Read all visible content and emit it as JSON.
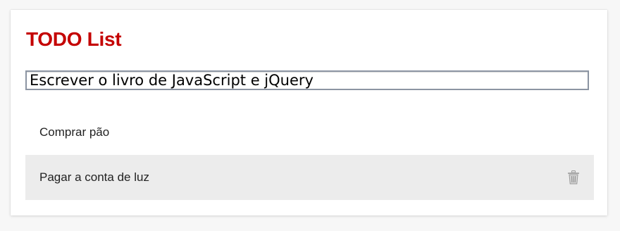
{
  "app": {
    "title": "TODO List"
  },
  "new_todo": {
    "value": "Escrever o livro de JavaScript e jQuery"
  },
  "todos": [
    {
      "label": "Comprar pão"
    },
    {
      "label": "Pagar a conta de luz"
    }
  ],
  "icons": {
    "delete": "trash-icon"
  },
  "colors": {
    "title": "#c40000",
    "hover_row": "#ececec",
    "input_border": "#8c95a3"
  }
}
